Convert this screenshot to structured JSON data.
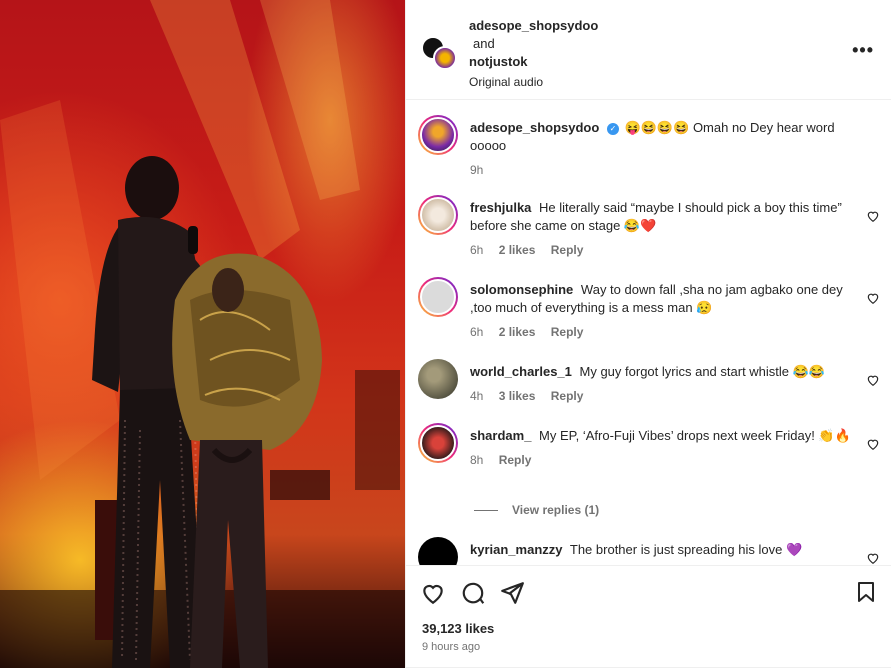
{
  "header": {
    "user1": "adesope_shopsydoo",
    "joiner": "and",
    "user2": "notjustok",
    "audio": "Original audio"
  },
  "caption": {
    "username": "adesope_shopsydoo",
    "text": "Omah no Dey hear word ooooo",
    "emoji": "😝😆😆😆",
    "time": "9h"
  },
  "comments": [
    {
      "username": "freshjulka",
      "text": "He literally said “maybe I should pick a boy this time” before she came on stage 😂❤️",
      "time": "6h",
      "likes": "2 likes",
      "reply": "Reply"
    },
    {
      "username": "solomonsephine",
      "text": "Way to down fall ,sha no jam agbako one dey ,too much of everything is a mess man 😥",
      "time": "6h",
      "likes": "2 likes",
      "reply": "Reply"
    },
    {
      "username": "world_charles_1",
      "text": "My guy forgot lyrics and start whistle 😂😂",
      "time": "4h",
      "likes": "3 likes",
      "reply": "Reply"
    },
    {
      "username": "shardam_",
      "text": "My EP, ‘Afro-Fuji Vibes’ drops next week Friday! 👏🔥",
      "time": "8h",
      "likes": "",
      "reply": "Reply"
    },
    {
      "username": "kyrian_manzzy",
      "text": "The brother is just spreading his love 💜",
      "time": "",
      "likes": "",
      "reply": ""
    }
  ],
  "view_replies": "View replies (1)",
  "footer": {
    "likes": "39,123 likes",
    "time": "9 hours ago"
  },
  "colors": {
    "stage_red": "#c81d17",
    "stage_orange": "#ff9a1f",
    "text": "#262626",
    "muted": "#737373",
    "verified": "#3897f0"
  }
}
